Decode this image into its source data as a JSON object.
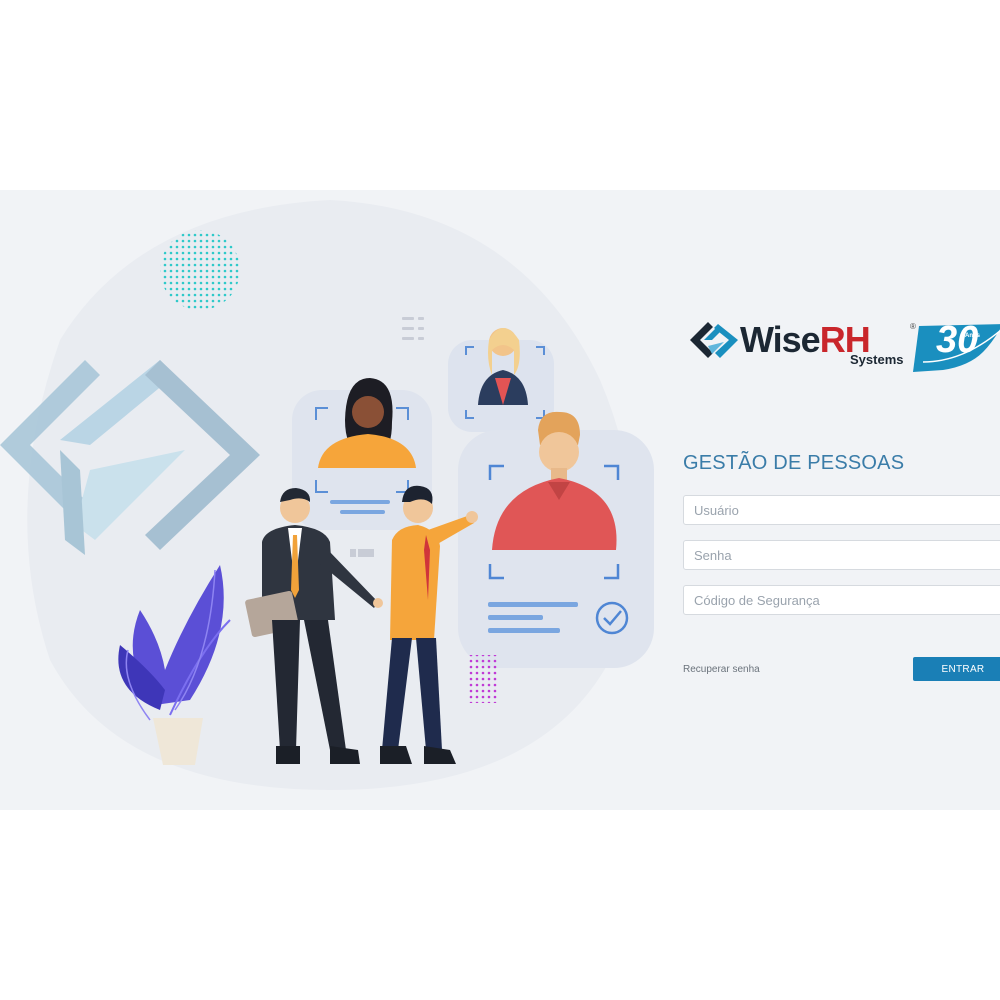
{
  "brand": {
    "name_dark": "Wise",
    "name_red": "RH",
    "registered": "®",
    "subtitle": "Systems",
    "anniversary_number": "30",
    "anniversary_label": "Anos",
    "colors": {
      "dark": "#1c2733",
      "red": "#c9262b",
      "teal": "#1a8fbf"
    }
  },
  "login": {
    "heading": "GESTÃO DE PESSOAS",
    "username_placeholder": "Usuário",
    "password_placeholder": "Senha",
    "security_code_placeholder": "Código de Segurança",
    "recover_link": "Recuperar senha",
    "submit_label": "ENTRAR",
    "accent_color": "#1a7fb6"
  },
  "illustration": {
    "icons": [
      "wiserh-emblem-icon",
      "dot-pattern-icon",
      "person-card-icon",
      "check-icon",
      "plant-icon"
    ]
  }
}
